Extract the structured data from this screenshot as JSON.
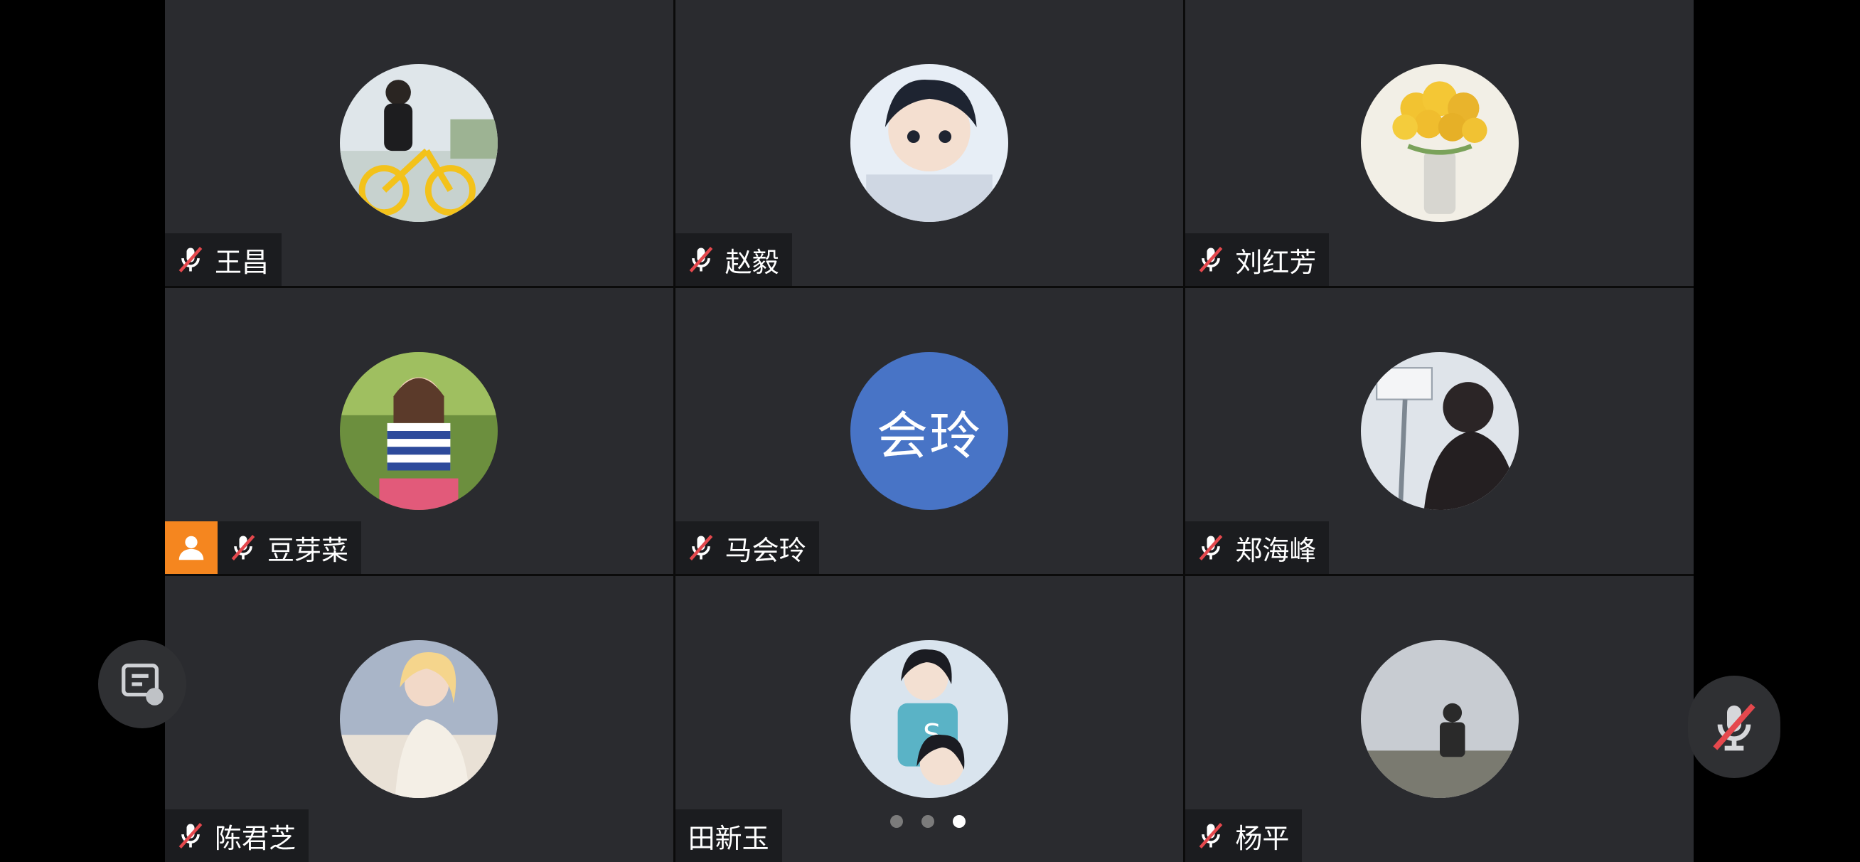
{
  "participants": [
    {
      "name": "王昌",
      "avatar": "photo-cyclist",
      "muted": true
    },
    {
      "name": "赵毅",
      "avatar": "photo-anime-boy",
      "muted": true
    },
    {
      "name": "刘红芳",
      "avatar": "photo-flowers",
      "muted": true
    },
    {
      "name": "豆芽菜",
      "avatar": "photo-girl",
      "muted": true,
      "host": true
    },
    {
      "name": "马会玲",
      "avatar_text": "会玲",
      "muted": true
    },
    {
      "name": "郑海峰",
      "avatar": "photo-masked-person",
      "muted": true
    },
    {
      "name": "陈君芝",
      "avatar": "photo-blonde-woman",
      "muted": true
    },
    {
      "name": "田新玉",
      "avatar": "photo-anime-girls",
      "muted": false
    },
    {
      "name": "杨平",
      "avatar": "photo-silhouette-sky",
      "muted": true
    }
  ],
  "pagination": {
    "pages": 3,
    "current": 3
  },
  "colors": {
    "tile_bg": "#2a2b2f",
    "host_badge": "#f5861f",
    "text_avatar": "#4874c6",
    "mute_slash": "#e5484d"
  },
  "controls": {
    "chat_icon": "chat-icon",
    "mic_icon": "mic-muted-icon"
  }
}
